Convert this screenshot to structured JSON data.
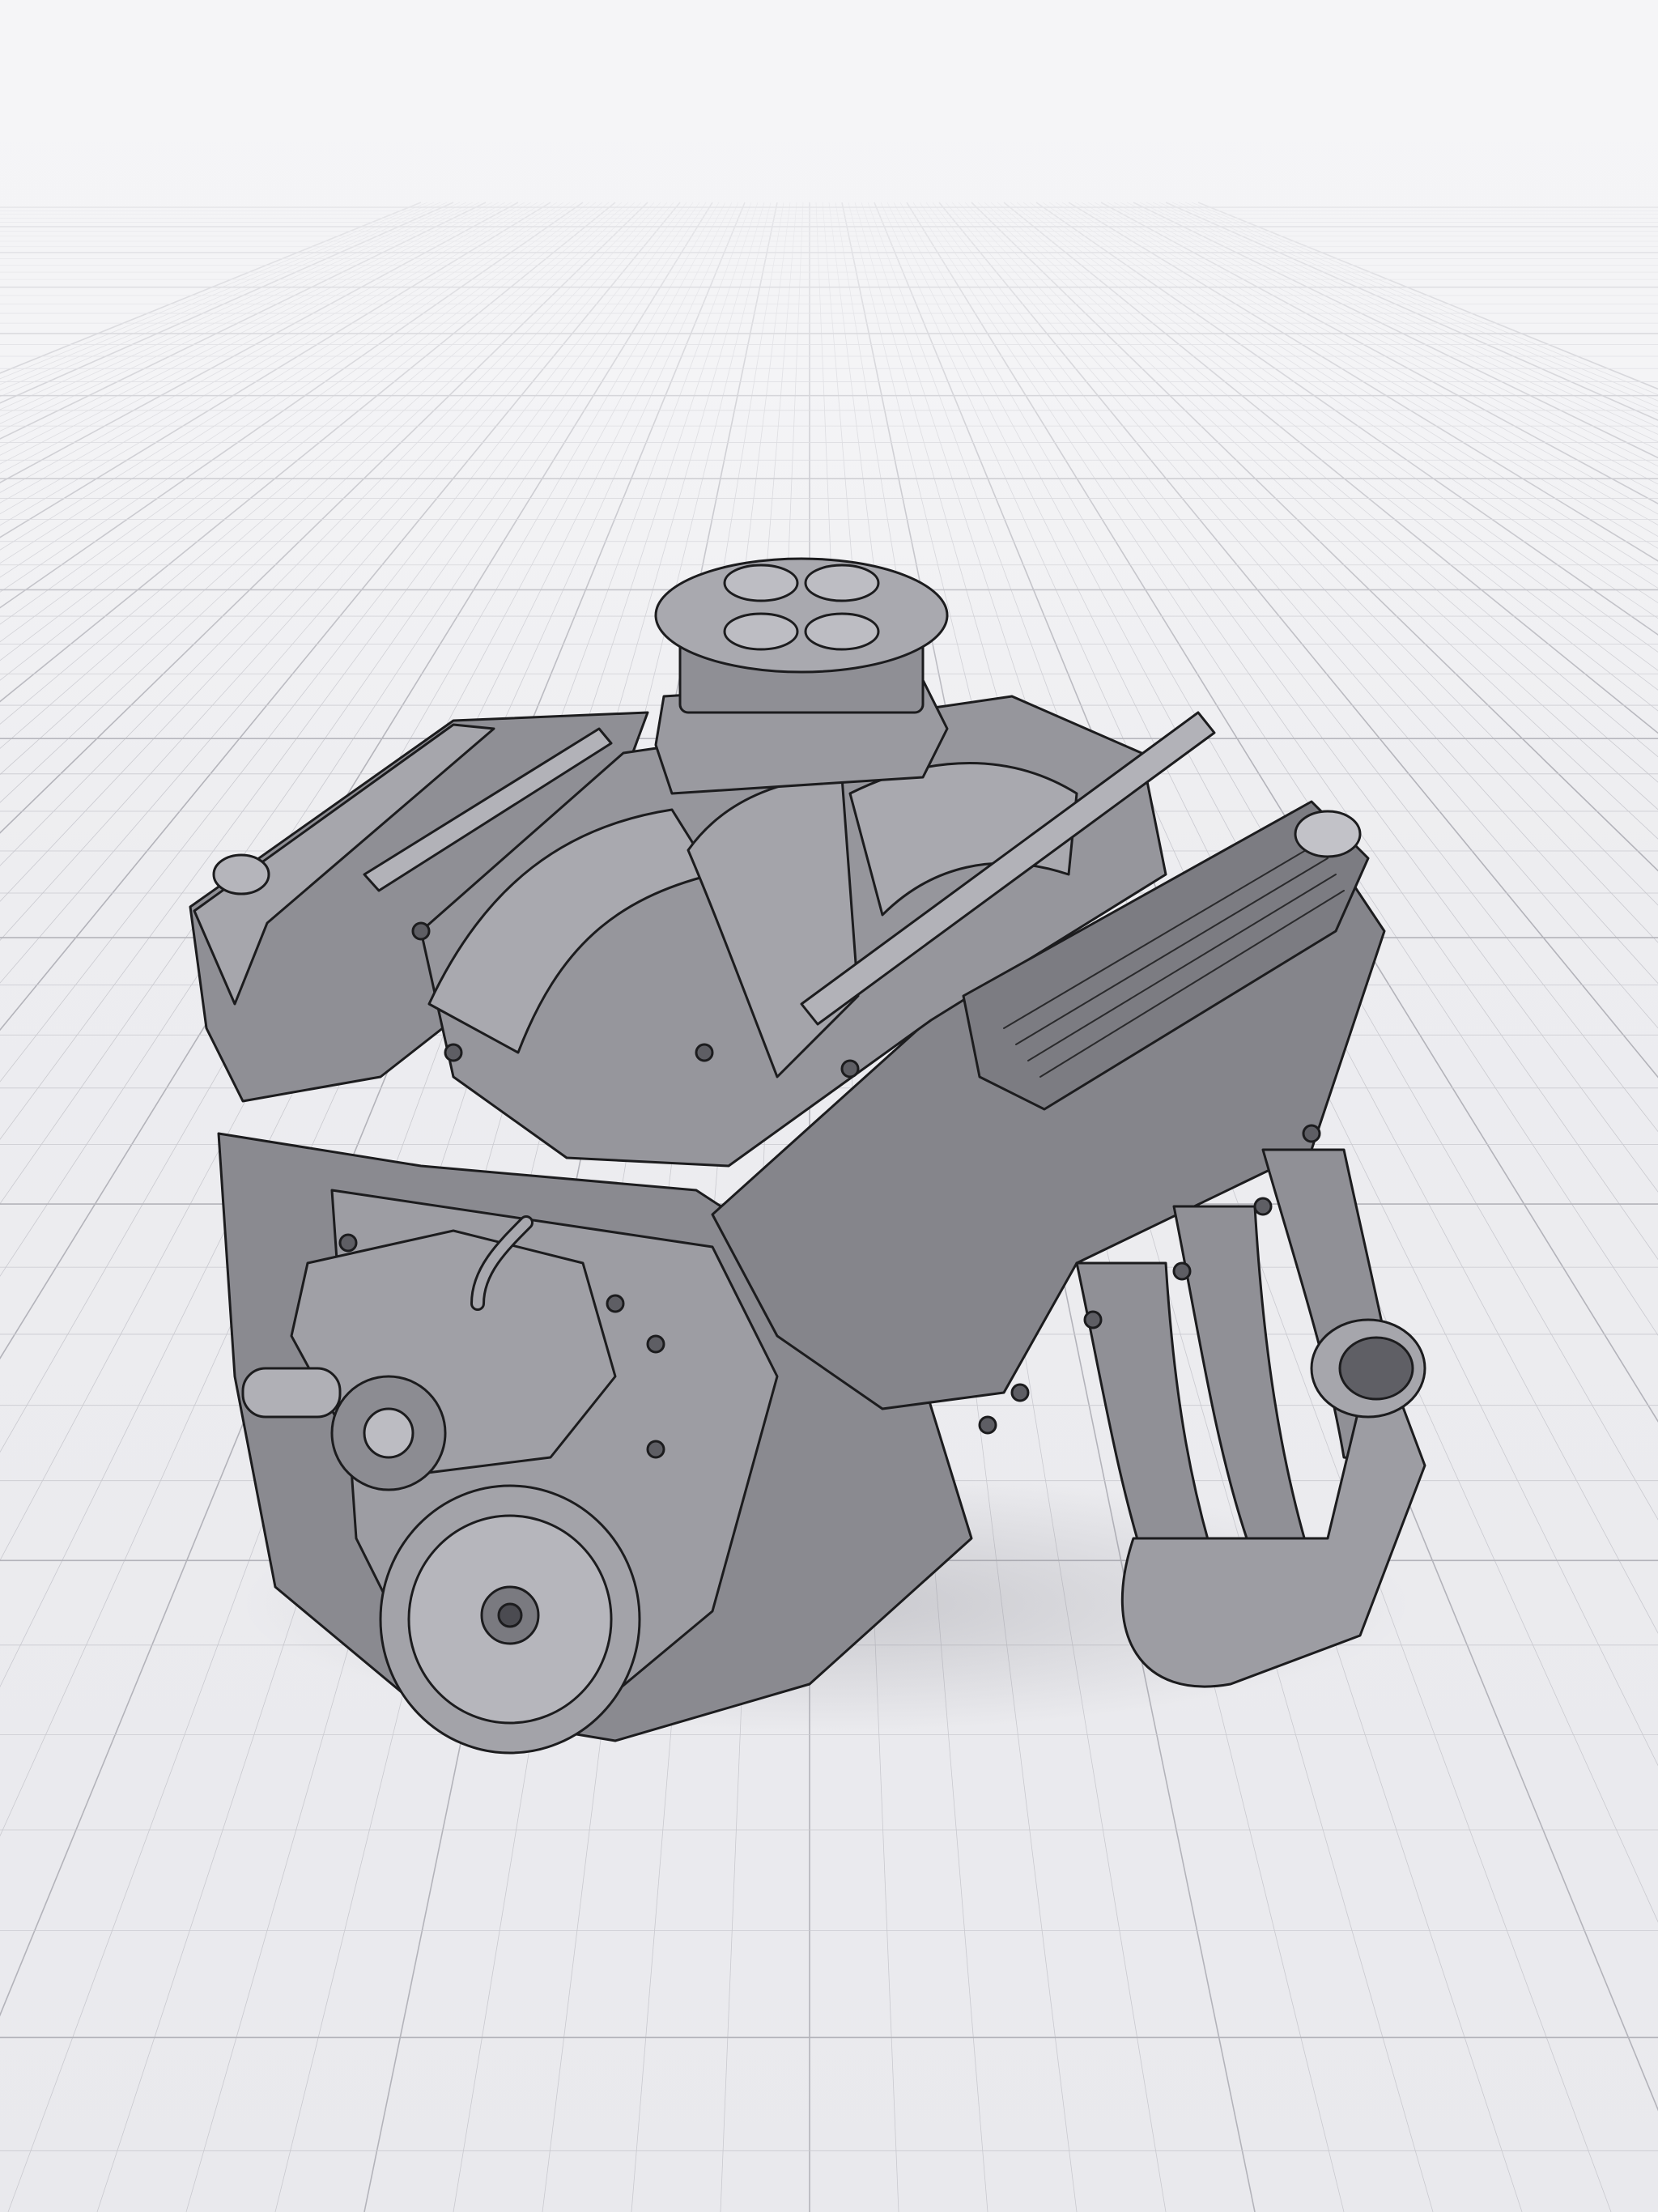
{
  "viewport": {
    "model": "engine-v8",
    "background_color": "#efeff2",
    "grid_color": "#c9c9cf",
    "grid_major_color": "#b3b3ba",
    "model_fill": "#8f8f95",
    "model_fill_light": "#a6a6ac",
    "model_fill_dark": "#6c6c72",
    "outline_color": "#1c1c1e"
  }
}
